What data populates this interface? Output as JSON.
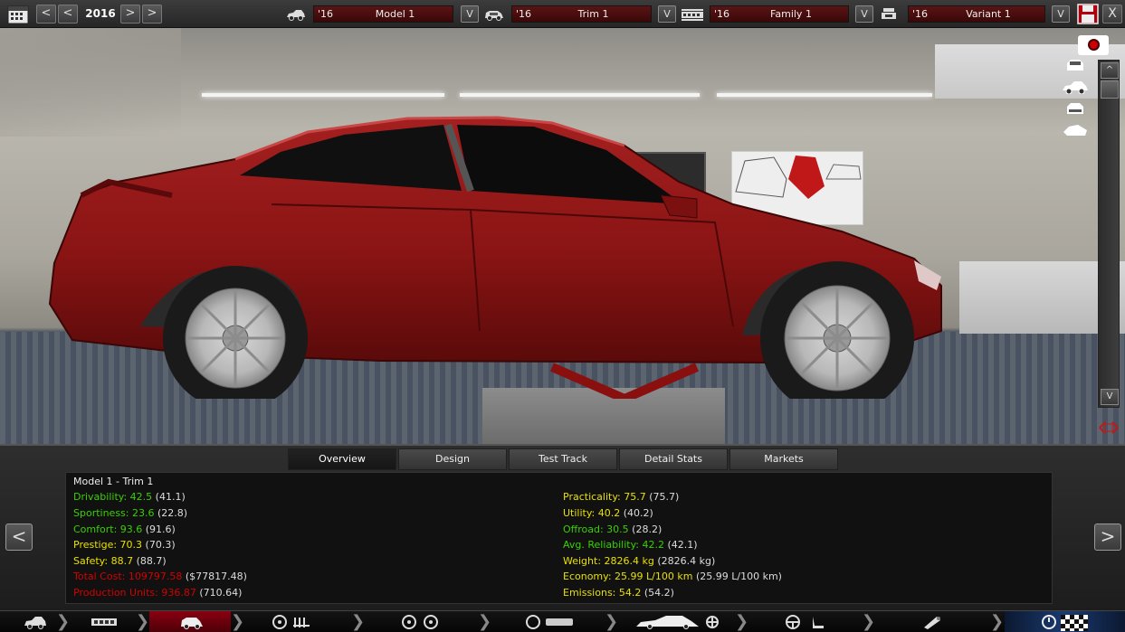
{
  "topbar": {
    "year": "2016",
    "prev2_label": "<",
    "prev_label": "<",
    "next_label": ">",
    "next2_label": ">",
    "selectors": [
      {
        "year": "'16",
        "name": "Model 1",
        "drop": "V"
      },
      {
        "year": "'16",
        "name": "Trim 1",
        "drop": "V"
      },
      {
        "year": "'16",
        "name": "Family 1",
        "drop": "V"
      },
      {
        "year": "'16",
        "name": "Variant 1",
        "drop": "V"
      }
    ],
    "close_label": "X"
  },
  "view_panel": {
    "scroll_up": "^",
    "scroll_down": "V"
  },
  "tabs": [
    "Overview",
    "Design",
    "Test Track",
    "Detail Stats",
    "Markets"
  ],
  "active_tab": "Overview",
  "nav": {
    "prev_label": "<",
    "next_label": ">"
  },
  "overview": {
    "title": "Model 1 - Trim 1",
    "left_stats": [
      {
        "label": "Drivability: 42.5",
        "ref": "(41.1)",
        "color": "#39d000"
      },
      {
        "label": "Sportiness: 23.6",
        "ref": "(22.8)",
        "color": "#39d000"
      },
      {
        "label": "Comfort: 93.6",
        "ref": "(91.6)",
        "color": "#39d000"
      },
      {
        "label": "Prestige: 70.3",
        "ref": "(70.3)",
        "color": "#e8e000"
      },
      {
        "label": "Safety: 88.7",
        "ref": "(88.7)",
        "color": "#e8e000"
      },
      {
        "label": "Total Cost: 109797.58",
        "ref": "($77817.48)",
        "color": "#d40000"
      },
      {
        "label": "Production Units: 936.87",
        "ref": "(710.64)",
        "color": "#d40000"
      }
    ],
    "right_stats": [
      {
        "label": "Practicality: 75.7",
        "ref": "(75.7)",
        "color": "#e8e000"
      },
      {
        "label": "Utility: 40.2",
        "ref": "(40.2)",
        "color": "#e8e000"
      },
      {
        "label": "Offroad: 30.5",
        "ref": "(28.2)",
        "color": "#39d000"
      },
      {
        "label": "Avg. Reliability: 42.2",
        "ref": "(42.1)",
        "color": "#39d000"
      },
      {
        "label": "Weight: 2826.4 kg",
        "ref": "(2826.4 kg)",
        "color": "#e8e000"
      },
      {
        "label": "Economy: 25.99 L/100 km",
        "ref": "(25.99 L/100 km)",
        "color": "#e8e000"
      },
      {
        "label": "Emissions: 54.2",
        "ref": "(54.2)",
        "color": "#e8e000"
      }
    ]
  },
  "colors": {
    "car_body": "#8a1414",
    "accent_red": "#b00010",
    "good": "#39d000",
    "ok": "#e8e000",
    "bad": "#d40000"
  },
  "footer_icons": [
    "model-icon",
    "family-icon",
    "trim-icon",
    "engine-icon",
    "chassis-icon",
    "suspension-icon",
    "body-design-icon",
    "interior-icon",
    "fuel-system-icon",
    "test-track-icon",
    "finish-icon"
  ]
}
